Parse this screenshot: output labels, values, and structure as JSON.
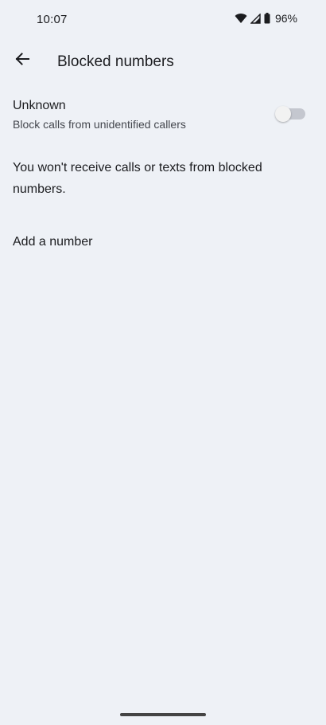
{
  "status_bar": {
    "time": "10:07",
    "battery": "96%"
  },
  "header": {
    "title": "Blocked numbers"
  },
  "unknown_setting": {
    "title": "Unknown",
    "subtitle": "Block calls from unidentified callers",
    "enabled": false
  },
  "info": {
    "text": "You won't receive calls or texts from blocked numbers."
  },
  "actions": {
    "add_number_label": "Add a number"
  },
  "icons": {
    "back": "arrow-back-icon",
    "wifi": "wifi-icon",
    "signal": "signal-icon",
    "battery": "battery-icon"
  },
  "colors": {
    "background": "#eef1f6",
    "text_primary": "#1b1c1f",
    "text_secondary": "#44474e",
    "switch_track_off": "#c4c7cf"
  }
}
